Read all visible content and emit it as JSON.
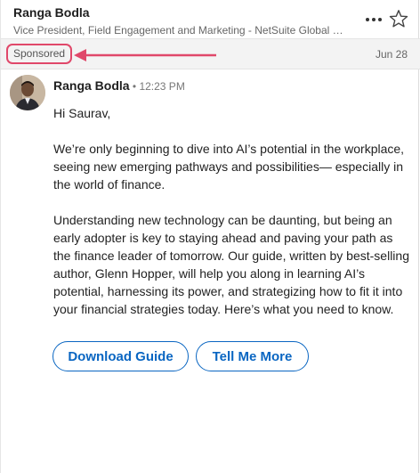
{
  "header": {
    "sender_name": "Ranga Bodla",
    "sender_title": "Vice President, Field Engagement and Marketing - NetSuite Global B..."
  },
  "meta": {
    "sponsored_label": "Sponsored",
    "date": "Jun 28"
  },
  "message": {
    "sender": "Ranga Bodla",
    "time": " • 12:23 PM",
    "paragraphs": [
      "Hi Saurav,",
      "We’re only beginning to dive into AI’s potential in the workplace, seeing new emerging pathways and possibilities— especially in the world of finance.",
      "Understanding new technology can be daunting, but being an early adopter is key to staying ahead and paving your path as the finance leader of tomorrow. Our guide, written by best-selling author, Glenn Hopper, will help you along in learning AI’s potential, harnessing its power, and strategizing how to fit it into your financial strategies today. Here’s what you need to know."
    ]
  },
  "actions": {
    "download_label": "Download Guide",
    "tell_label": "Tell Me More"
  },
  "colors": {
    "accent": "#0a66c2",
    "annotation": "#e0486a"
  },
  "icons": {
    "more": "more-horizontal-icon",
    "star": "star-outline-icon",
    "arrow": "left-arrow-annotation"
  }
}
